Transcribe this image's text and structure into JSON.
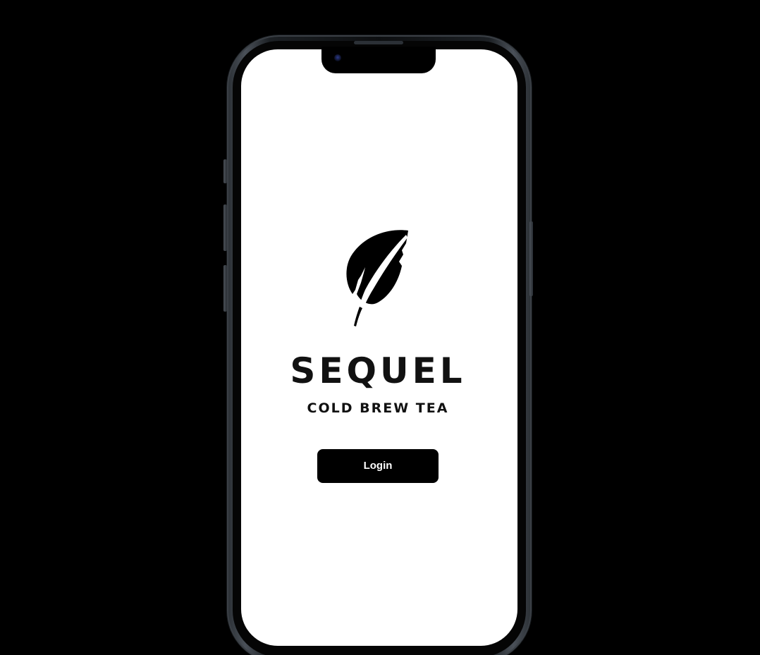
{
  "brand": {
    "name": "SEQUEL",
    "tagline": "COLD BREW TEA",
    "logo_icon": "feather-icon"
  },
  "actions": {
    "login_label": "Login"
  },
  "colors": {
    "background": "#000000",
    "screen": "#ffffff",
    "button_bg": "#000000",
    "button_text": "#ffffff",
    "text": "#111111"
  }
}
